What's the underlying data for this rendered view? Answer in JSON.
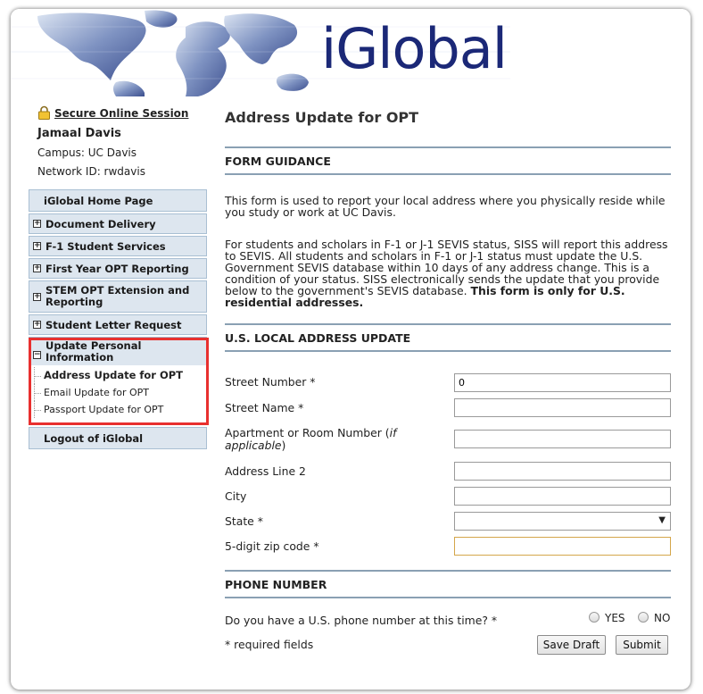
{
  "header": {
    "brand": "iGlobal"
  },
  "session": {
    "secure_label": "Secure Online Session",
    "name": "Jamaal Davis",
    "campus": "Campus: UC Davis",
    "network_id": "Network ID: rwdavis"
  },
  "nav": {
    "home": "iGlobal Home Page",
    "items": [
      "Document Delivery",
      "F-1 Student Services",
      "First Year OPT Reporting",
      "STEM OPT Extension and Reporting",
      "Student Letter Request",
      "Update Personal Information"
    ],
    "sub_items": [
      "Address Update for OPT",
      "Email Update for OPT",
      "Passport Update for OPT"
    ],
    "logout": "Logout of iGlobal"
  },
  "main": {
    "title": "Address Update for OPT",
    "guidance_heading": "FORM GUIDANCE",
    "guidance_p1": "This form is used to report your local address where you physically reside while you study or work at UC Davis.",
    "guidance_p2": "For students and scholars in F-1 or J-1 SEVIS status, SISS will report this address to SEVIS. All students and scholars in F-1 or J-1 status must update the U.S. Government SEVIS database within 10 days of any address change. This is a condition of your status.  SISS electronically sends the update that you provide below to the government's SEVIS database.",
    "guidance_p2_bold": "This form is only for U.S. residential addresses.",
    "address_heading": "U.S. LOCAL ADDRESS UPDATE",
    "fields": {
      "street_number": {
        "label": "Street Number *",
        "value": "0"
      },
      "street_name": {
        "label": "Street Name *",
        "value": ""
      },
      "apartment": {
        "label": "Apartment or Room Number (",
        "label_italic": "if applicable",
        "label_end": ")",
        "value": ""
      },
      "address_line2": {
        "label": "Address Line 2",
        "value": ""
      },
      "city": {
        "label": "City",
        "value": ""
      },
      "state": {
        "label": "State *",
        "value": ""
      },
      "zip": {
        "label": "5-digit zip code *",
        "value": ""
      }
    },
    "phone_heading": "PHONE NUMBER",
    "phone_question": "Do you have a U.S. phone number at this time? *",
    "phone_yes": "YES",
    "phone_no": "NO",
    "required_note": "* required fields",
    "save_draft": "Save Draft",
    "submit": "Submit"
  }
}
